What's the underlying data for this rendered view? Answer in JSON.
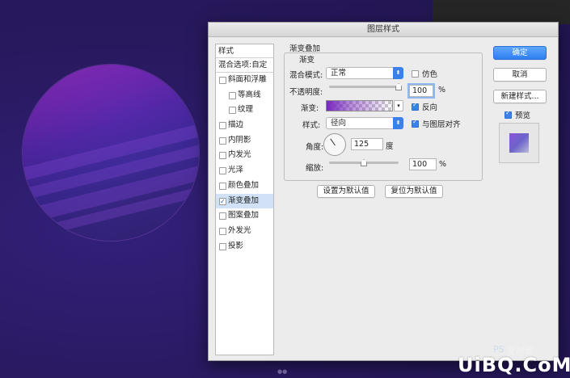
{
  "dialog": {
    "title": "图层样式"
  },
  "style_list": {
    "header": "样式",
    "blend_options": "混合选项:自定",
    "items": [
      {
        "label": "斜面和浮雕",
        "checked": false,
        "indent": false
      },
      {
        "label": "等高线",
        "checked": false,
        "indent": true
      },
      {
        "label": "纹理",
        "checked": false,
        "indent": true
      },
      {
        "label": "描边",
        "checked": false,
        "indent": false
      },
      {
        "label": "内阴影",
        "checked": false,
        "indent": false
      },
      {
        "label": "内发光",
        "checked": false,
        "indent": false
      },
      {
        "label": "光泽",
        "checked": false,
        "indent": false
      },
      {
        "label": "颜色叠加",
        "checked": false,
        "indent": false
      },
      {
        "label": "渐变叠加",
        "checked": true,
        "indent": false
      },
      {
        "label": "图案叠加",
        "checked": false,
        "indent": false
      },
      {
        "label": "外发光",
        "checked": false,
        "indent": false
      },
      {
        "label": "投影",
        "checked": false,
        "indent": false
      }
    ]
  },
  "gradient_overlay": {
    "section_title": "渐变叠加",
    "sub_title": "渐变",
    "blend_mode_label": "混合模式:",
    "blend_mode_value": "正常",
    "dither_label": "仿色",
    "dither_checked": false,
    "opacity_label": "不透明度:",
    "opacity_value": "100",
    "opacity_unit": "%",
    "opacity_level": 1.0,
    "gradient_label": "渐变:",
    "reverse_label": "反向",
    "reverse_checked": true,
    "style_label": "样式:",
    "style_value": "径向",
    "align_label": "与图层对齐",
    "align_checked": true,
    "angle_label": "角度:",
    "angle_value": "125",
    "angle_unit": "度",
    "scale_label": "缩放:",
    "scale_value": "100",
    "scale_unit": "%",
    "scale_level": 0.5,
    "make_default_label": "设置为默认值",
    "reset_default_label": "复位为默认值"
  },
  "buttons": {
    "ok": "确定",
    "cancel": "取消",
    "new_style": "新建样式...",
    "preview_label": "预览",
    "preview_checked": true
  },
  "watermark": {
    "brand": "UiBQ.CoM",
    "ps_text": "PS",
    "tagline": "爱好者"
  },
  "colors": {
    "accent": "#3b82e8",
    "canvas": "#2a1a5e",
    "gradient_start": "#7828be"
  }
}
